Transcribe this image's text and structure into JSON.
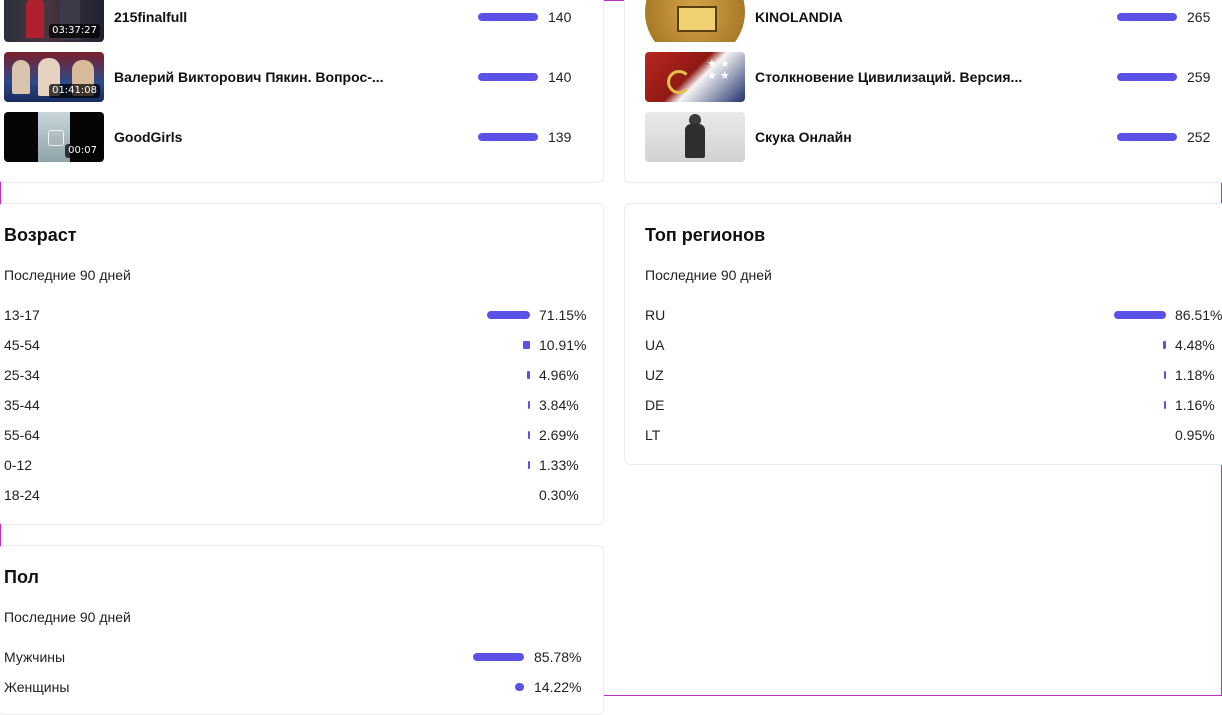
{
  "top_videos_left": [
    {
      "title": "215finalfull",
      "duration": "03:37:27",
      "count": "140"
    },
    {
      "title": "Валерий Викторович Пякин. Вопрос-...",
      "duration": "01:41:08",
      "count": "140"
    },
    {
      "title": "GoodGirls",
      "duration": "00:07",
      "count": "139"
    }
  ],
  "top_videos_right": [
    {
      "title": "KINOLANDIA",
      "count": "265"
    },
    {
      "title": "Столкновение Цивилизаций. Версия...",
      "count": "259"
    },
    {
      "title": "Скука Онлайн",
      "count": "252"
    }
  ],
  "age": {
    "title": "Возраст",
    "period": "Последние 90 дней",
    "rows": [
      {
        "label": "13-17",
        "value": "71.15%",
        "fraction": 0.7115
      },
      {
        "label": "45-54",
        "value": "10.91%",
        "fraction": 0.1091
      },
      {
        "label": "25-34",
        "value": "4.96%",
        "fraction": 0.0496
      },
      {
        "label": "35-44",
        "value": "3.84%",
        "fraction": 0.0384
      },
      {
        "label": "55-64",
        "value": "2.69%",
        "fraction": 0.0269
      },
      {
        "label": "0-12",
        "value": "1.33%",
        "fraction": 0.0133
      },
      {
        "label": "18-24",
        "value": "0.30%",
        "fraction": 0.003
      }
    ]
  },
  "regions": {
    "title": "Топ регионов",
    "period": "Последние 90 дней",
    "rows": [
      {
        "label": "RU",
        "value": "86.51%",
        "fraction": 0.8651
      },
      {
        "label": "UA",
        "value": "4.48%",
        "fraction": 0.0448
      },
      {
        "label": "UZ",
        "value": "1.18%",
        "fraction": 0.0118
      },
      {
        "label": "DE",
        "value": "1.16%",
        "fraction": 0.0116
      },
      {
        "label": "LT",
        "value": "0.95%",
        "fraction": 0.0095
      }
    ]
  },
  "gender": {
    "title": "Пол",
    "period": "Последние 90 дней",
    "rows": [
      {
        "label": "Мужчины",
        "value": "85.78%",
        "fraction": 0.8578
      },
      {
        "label": "Женщины",
        "value": "14.22%",
        "fraction": 0.1422
      }
    ]
  },
  "colors": {
    "bar": "#5b51e6",
    "card_border": "#ececec",
    "window_border": "#c030c0"
  }
}
